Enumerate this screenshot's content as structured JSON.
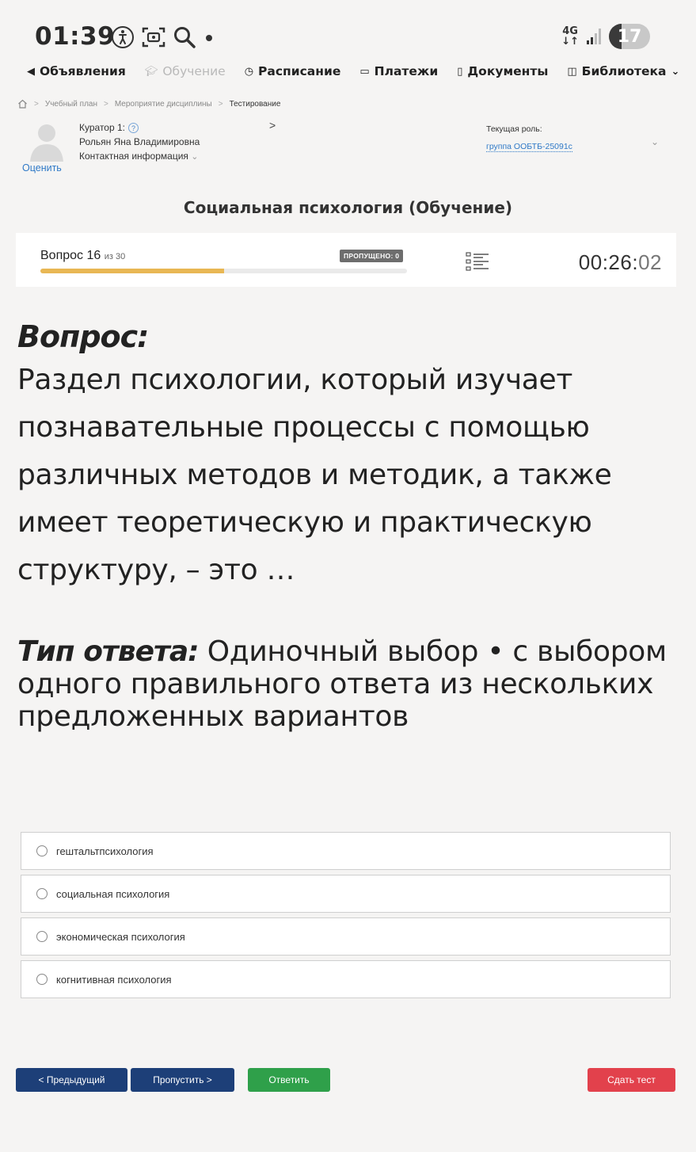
{
  "status_bar": {
    "time": "01:39",
    "network": "4G",
    "battery": "17",
    "icons": [
      "accessibility-icon",
      "screenshot-icon",
      "search-icon",
      "dot-icon"
    ]
  },
  "nav": {
    "items": [
      {
        "label": "Объявления",
        "icon": "megaphone-icon",
        "disabled": false
      },
      {
        "label": "Обучение",
        "icon": "graduation-cap-icon",
        "disabled": true
      },
      {
        "label": "Расписание",
        "icon": "clock-icon",
        "disabled": false
      },
      {
        "label": "Платежи",
        "icon": "card-icon",
        "disabled": false
      },
      {
        "label": "Документы",
        "icon": "document-icon",
        "disabled": false
      },
      {
        "label": "Библиотека",
        "icon": "book-icon",
        "disabled": false
      }
    ]
  },
  "breadcrumb": {
    "items": [
      "Учебный план",
      "Мероприятие дисциплины",
      "Тестирование"
    ]
  },
  "curator": {
    "title": "Куратор 1:",
    "name": "Рольян Яна Владимировна",
    "contact": "Контактная информация",
    "rate": "Оценить"
  },
  "role": {
    "label": "Текущая роль:",
    "value": "группа ООБТБ-25091с"
  },
  "course_title": "Социальная психология (Обучение)",
  "progress": {
    "question_label": "Вопрос 16",
    "of_label": "из 30",
    "current": 16,
    "total": 30,
    "fill_fraction": 0.5,
    "skipped_label": "ПРОПУЩЕНО: 0",
    "timer_main": "00:26:",
    "timer_seconds": "02"
  },
  "question": {
    "heading": "Вопрос:",
    "text": "Раздел психологии, который изучает познавательные процессы с помощью различных методов и методик, а также имеет теоретическую и практическую структуру, – это …"
  },
  "answer_type": {
    "label": "Тип ответа:",
    "value": "Одиночный выбор • с выбором одного правильного ответа из нескольких предложенных вариантов"
  },
  "options": [
    "гештальтпсихология",
    "социальная психология",
    "экономическая психология",
    "когнитивная психология"
  ],
  "buttons": {
    "prev": "< Предыдущий",
    "skip": "Пропустить >",
    "answer": "Ответить",
    "submit": "Сдать тест"
  },
  "colors": {
    "primary": "#1d3f78",
    "success": "#2fa04a",
    "danger": "#e2414c",
    "progress": "#e8b754",
    "link": "#2f79c7"
  }
}
